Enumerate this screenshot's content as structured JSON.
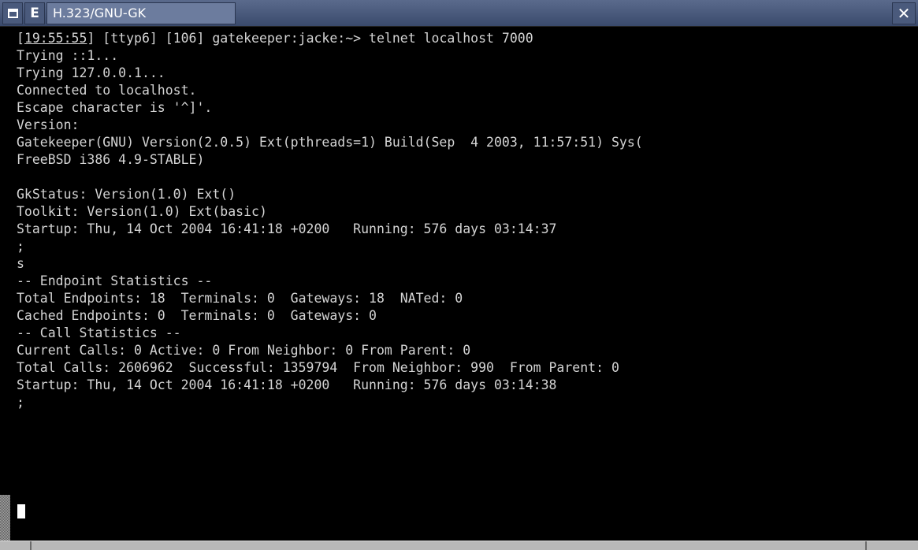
{
  "window": {
    "title": "H.323/GNU-GK",
    "menu_icon": "window-menu-icon",
    "e_label": "E",
    "close_label": "✕"
  },
  "terminal": {
    "prompt": {
      "open_bracket": "[",
      "time": "19:55:55",
      "rest": "] [ttyp6] [106] gatekeeper:jacke:~> telnet localhost 7000"
    },
    "lines": [
      "Trying ::1...",
      "Trying 127.0.0.1...",
      "Connected to localhost.",
      "Escape character is '^]'.",
      "Version:",
      "Gatekeeper(GNU) Version(2.0.5) Ext(pthreads=1) Build(Sep  4 2003, 11:57:51) Sys(",
      "FreeBSD i386 4.9-STABLE)",
      "",
      "GkStatus: Version(1.0) Ext()",
      "Toolkit: Version(1.0) Ext(basic)",
      "Startup: Thu, 14 Oct 2004 16:41:18 +0200   Running: 576 days 03:14:37",
      ";",
      "s",
      "-- Endpoint Statistics --",
      "Total Endpoints: 18  Terminals: 0  Gateways: 18  NATed: 0",
      "Cached Endpoints: 0  Terminals: 0  Gateways: 0",
      "-- Call Statistics --",
      "Current Calls: 0 Active: 0 From Neighbor: 0 From Parent: 0",
      "Total Calls: 2606962  Successful: 1359794  From Neighbor: 990  From Parent: 0",
      "Startup: Thu, 14 Oct 2004 16:41:18 +0200   Running: 576 days 03:14:38",
      ";"
    ]
  },
  "colors": {
    "background": "#000000",
    "text": "#d4d4d4",
    "titlebar": "#4a5a7c",
    "cursor": "#ffffff"
  }
}
